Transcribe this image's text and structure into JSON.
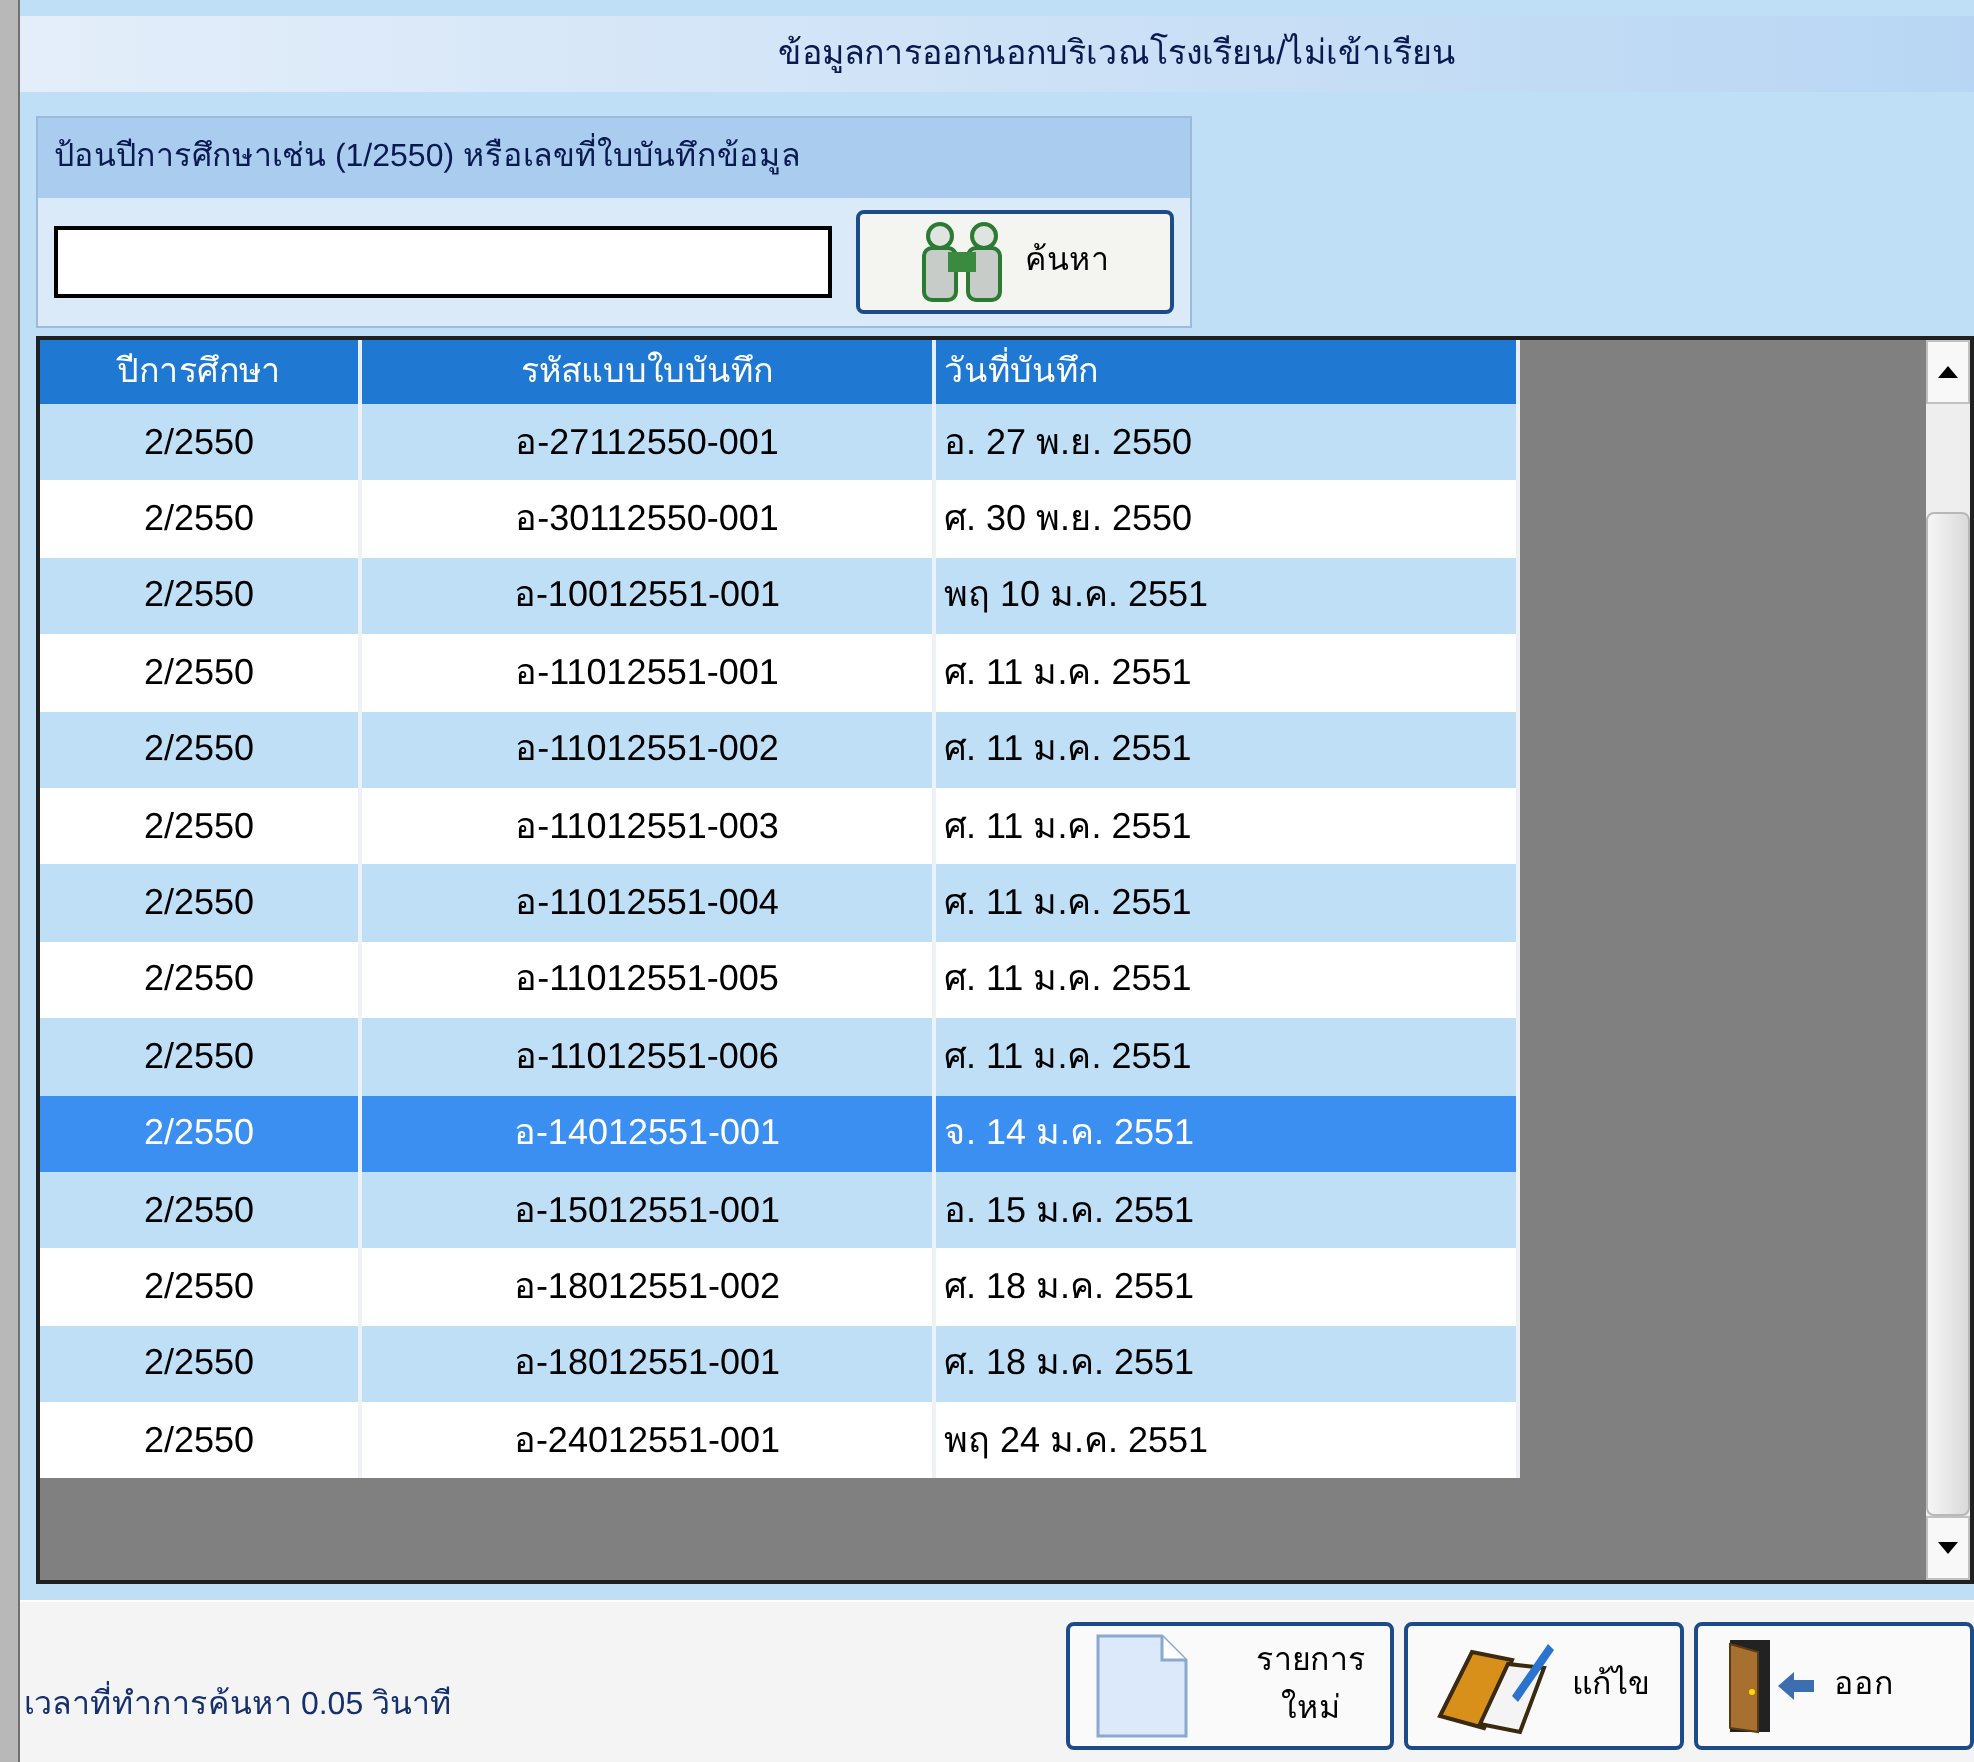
{
  "window": {
    "title": "ข้อมูลการออกนอกบริเวณโรงเรียน/ไม่เข้าเรียน"
  },
  "search": {
    "label": "ป้อนปีการศึกษาเช่น (1/2550) หรือเลขที่ใบบันทึกข้อมูล",
    "button": "ค้นหา"
  },
  "table": {
    "columns": [
      "ปีการศึกษา",
      "รหัสแบบใบบันทึก",
      "วันที่บันทึก"
    ],
    "rows": [
      {
        "cells": [
          "2/2550",
          "อ-27112550-001",
          "อ. 27 พ.ย. 2550"
        ],
        "selected": false
      },
      {
        "cells": [
          "2/2550",
          "อ-30112550-001",
          "ศ. 30 พ.ย. 2550"
        ],
        "selected": false
      },
      {
        "cells": [
          "2/2550",
          "อ-10012551-001",
          "พฤ 10 ม.ค. 2551"
        ],
        "selected": false
      },
      {
        "cells": [
          "2/2550",
          "อ-11012551-001",
          "ศ. 11 ม.ค. 2551"
        ],
        "selected": false
      },
      {
        "cells": [
          "2/2550",
          "อ-11012551-002",
          "ศ. 11 ม.ค. 2551"
        ],
        "selected": false
      },
      {
        "cells": [
          "2/2550",
          "อ-11012551-003",
          "ศ. 11 ม.ค. 2551"
        ],
        "selected": false
      },
      {
        "cells": [
          "2/2550",
          "อ-11012551-004",
          "ศ. 11 ม.ค. 2551"
        ],
        "selected": false
      },
      {
        "cells": [
          "2/2550",
          "อ-11012551-005",
          "ศ. 11 ม.ค. 2551"
        ],
        "selected": false
      },
      {
        "cells": [
          "2/2550",
          "อ-11012551-006",
          "ศ. 11 ม.ค. 2551"
        ],
        "selected": false
      },
      {
        "cells": [
          "2/2550",
          "อ-14012551-001",
          "จ. 14 ม.ค. 2551"
        ],
        "selected": true
      },
      {
        "cells": [
          "2/2550",
          "อ-15012551-001",
          "อ. 15 ม.ค. 2551"
        ],
        "selected": false
      },
      {
        "cells": [
          "2/2550",
          "อ-18012551-002",
          "ศ. 18 ม.ค. 2551"
        ],
        "selected": false
      },
      {
        "cells": [
          "2/2550",
          "อ-18012551-001",
          "ศ. 18 ม.ค. 2551"
        ],
        "selected": false
      },
      {
        "cells": [
          "2/2550",
          "อ-24012551-001",
          "พฤ 24 ม.ค. 2551"
        ],
        "selected": false
      }
    ]
  },
  "status_bar": {
    "text": "เวลาที่ทำการค้นหา 0.05 วินาที"
  },
  "buttons": [
    {
      "kind": "new",
      "label": "รายการ\nใหม่"
    },
    {
      "kind": "edit",
      "label": "แก้ไข"
    },
    {
      "kind": "exit",
      "label": "ออก"
    }
  ]
}
